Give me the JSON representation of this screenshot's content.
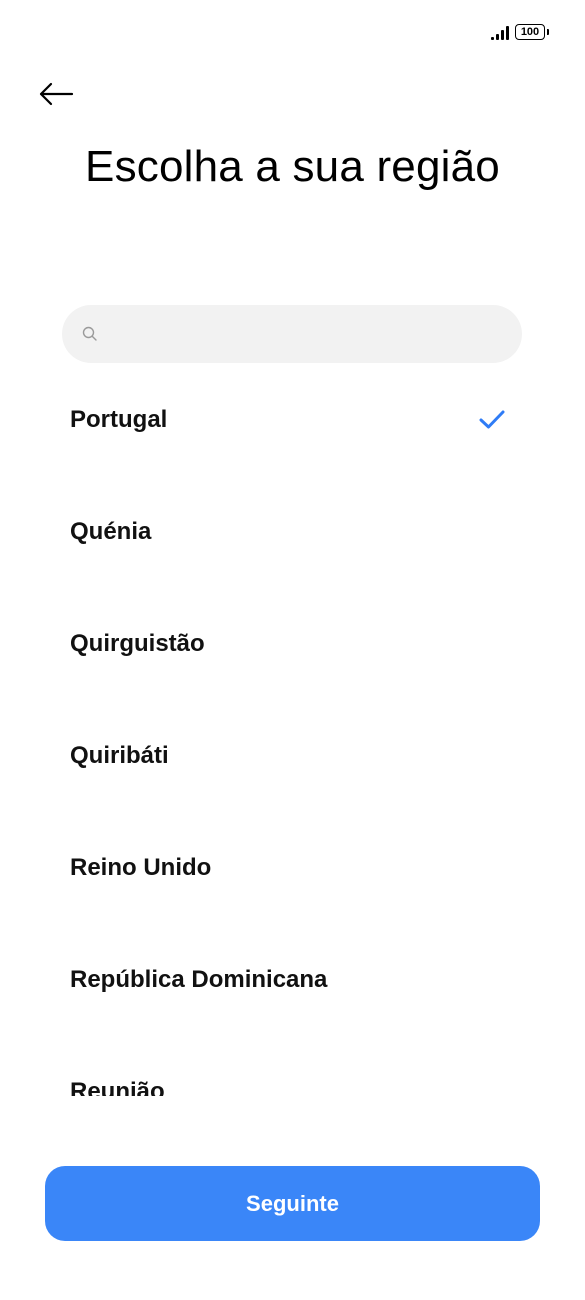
{
  "status_bar": {
    "battery_level": "100",
    "signal_bars": 4
  },
  "header": {
    "back_icon": "arrow-left-icon",
    "title": "Escolha a sua região"
  },
  "search": {
    "icon": "search-icon",
    "value": "",
    "placeholder": ""
  },
  "regions": {
    "selected": "Portugal",
    "items": [
      {
        "label": "Portugal",
        "selected": true
      },
      {
        "label": "Quénia",
        "selected": false
      },
      {
        "label": "Quirguistão",
        "selected": false
      },
      {
        "label": "Quiribáti",
        "selected": false
      },
      {
        "label": "Reino Unido",
        "selected": false
      },
      {
        "label": "República Dominicana",
        "selected": false
      },
      {
        "label": "Reunião",
        "selected": false
      }
    ]
  },
  "footer": {
    "next_label": "Seguinte"
  },
  "colors": {
    "accent": "#3a86f8",
    "check": "#2f7cf6",
    "search_bg": "#f2f2f2"
  }
}
